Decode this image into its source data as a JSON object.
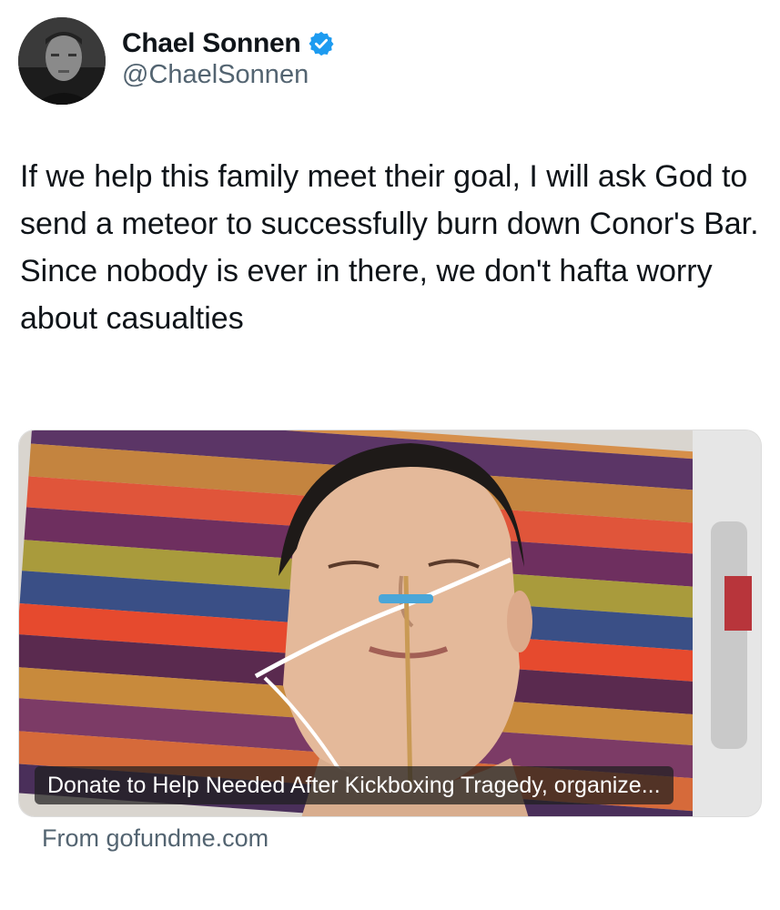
{
  "author": {
    "display_name": "Chael Sonnen",
    "handle": "@ChaelSonnen",
    "verified_icon": "verified-badge-icon",
    "avatar_icon": "profile-photo"
  },
  "tweet": {
    "lines": [
      "If we help this family meet their goal, I will ask God to send a meteor to successfully burn down Conor's Bar.",
      "Since nobody is ever in there, we don't hafta worry about casualties"
    ]
  },
  "link_card": {
    "title": "Donate to Help Needed After Kickboxing Tragedy, organize...",
    "domain_text": "From gofundme.com",
    "image": "hospital-patient-photo"
  },
  "colors": {
    "text_primary": "#0f1419",
    "text_secondary": "#536471",
    "verified_blue": "#1d9bf0"
  }
}
